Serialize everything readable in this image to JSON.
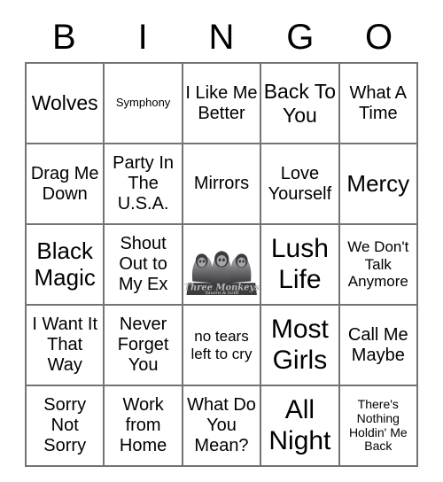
{
  "header": {
    "letters": [
      "B",
      "I",
      "N",
      "G",
      "O"
    ]
  },
  "grid": {
    "rows": 5,
    "columns": 5,
    "border_color": "#737373",
    "background_color": "#ffffff",
    "text_color": "#000000",
    "cells": [
      {
        "text": "Wolves",
        "size": "lg"
      },
      {
        "text": "Symphony",
        "size": "xxs"
      },
      {
        "text": "I Like Me Better",
        "size": "md"
      },
      {
        "text": "Back To You",
        "size": "lg"
      },
      {
        "text": "What A Time",
        "size": "md"
      },
      {
        "text": "Drag Me Down",
        "size": "md"
      },
      {
        "text": "Party In The U.S.A.",
        "size": "md"
      },
      {
        "text": "Mirrors",
        "size": "md"
      },
      {
        "text": "Love Yourself",
        "size": "md"
      },
      {
        "text": "Mercy",
        "size": "xl"
      },
      {
        "text": "Black Magic",
        "size": "xl"
      },
      {
        "text": "Shout Out to My Ex",
        "size": "md"
      },
      {
        "text": "",
        "size": "md",
        "free_space": true
      },
      {
        "text": "Lush Life",
        "size": "xxl"
      },
      {
        "text": "We Don't Talk Anymore",
        "size": "sm"
      },
      {
        "text": "I Want It That Way",
        "size": "md"
      },
      {
        "text": "Never Forget You",
        "size": "md"
      },
      {
        "text": "no tears left to cry",
        "size": "sm"
      },
      {
        "text": "Most Girls",
        "size": "xxl"
      },
      {
        "text": "Call Me Maybe",
        "size": "md"
      },
      {
        "text": "Sorry Not Sorry",
        "size": "md"
      },
      {
        "text": "Work from Home",
        "size": "md"
      },
      {
        "text": "What Do You Mean?",
        "size": "md"
      },
      {
        "text": "All Night",
        "size": "xxl"
      },
      {
        "text": "There's Nothing Holdin' Me Back",
        "size": "xs"
      }
    ]
  },
  "free_space": {
    "type": "logo-image",
    "brand_name": "Three Monkeys",
    "brand_tagline": "Tavern & Grill",
    "description": "three hooded monkey figures (see/hear/speak no evil)",
    "colors": {
      "dark": "#3c3c3f",
      "mid": "#6e6e73",
      "light": "#b9b9bd",
      "background": "#ffffff"
    }
  }
}
